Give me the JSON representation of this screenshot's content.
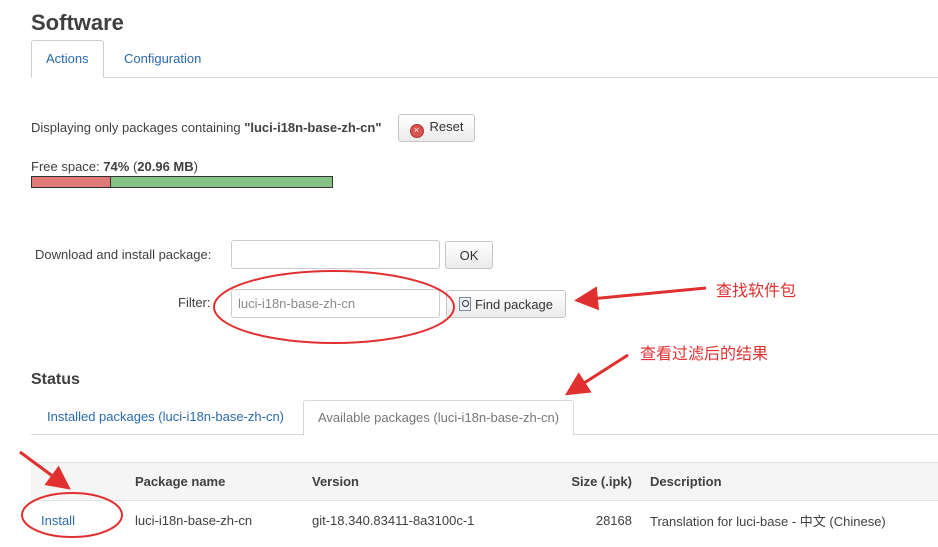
{
  "page": {
    "title": "Software"
  },
  "tabs": [
    {
      "label": "Actions",
      "active": true
    },
    {
      "label": "Configuration",
      "active": false
    }
  ],
  "filter_notice": {
    "prefix": "Displaying only packages containing",
    "query": "\"luci-i18n-base-zh-cn\""
  },
  "reset_button": {
    "label": "Reset",
    "icon": "reset-icon",
    "icon_color": "#d9534f"
  },
  "free_space": {
    "label": "Free space:",
    "percent_text": "74%",
    "size_text": "20.96 MB",
    "used_fraction": 0.26,
    "used_color": "#e07a7a",
    "free_color": "#86c286"
  },
  "download": {
    "label": "Download and install package:",
    "value": "",
    "ok_label": "OK"
  },
  "filter": {
    "label": "Filter:",
    "placeholder": "luci-i18n-base-zh-cn",
    "find_label": "Find package",
    "find_icon": "search-icon"
  },
  "annotations": {
    "find": "查找软件包",
    "view": "查看过滤后的结果",
    "color": "#e03030"
  },
  "status": {
    "heading": "Status",
    "tabs": [
      {
        "label": "Installed packages (luci-i18n-base-zh-cn)",
        "active": false
      },
      {
        "label": "Available packages (luci-i18n-base-zh-cn)",
        "active": true
      }
    ]
  },
  "table": {
    "headers": [
      "",
      "Package name",
      "Version",
      "Size (.ipk)",
      "Description"
    ],
    "rows": [
      {
        "action": "Install",
        "name": "luci-i18n-base-zh-cn",
        "version": "git-18.340.83411-8a3100c-1",
        "size": "28168",
        "description": "Translation for luci-base - 中文 (Chinese)"
      }
    ]
  },
  "colors": {
    "link": "#2a6aad",
    "accent_red": "#e03030"
  }
}
